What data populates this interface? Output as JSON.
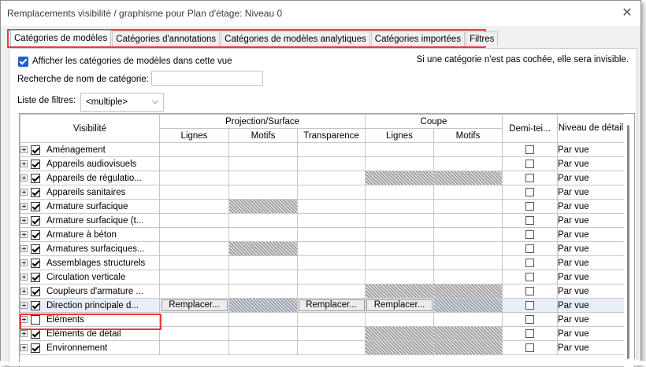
{
  "window": {
    "title": "Remplacements visibilité / graphisme pour Plan d'étage: Niveau 0",
    "close_icon": "close-icon"
  },
  "tabs": [
    {
      "label": "Catégories de modèles",
      "active": true
    },
    {
      "label": "Catégories d'annotations",
      "active": false
    },
    {
      "label": "Catégories de modèles analytiques",
      "active": false
    },
    {
      "label": "Catégories importées",
      "active": false
    },
    {
      "label": "Filtres",
      "active": false
    }
  ],
  "options": {
    "show_label": "Afficher les catégories de modèles dans cette vue",
    "show_checked": true,
    "hint": "Si une catégorie n'est pas cochée, elle sera invisible.",
    "search_label": "Recherche de nom de catégorie:",
    "search_value": "",
    "filter_label": "Liste de filtres:",
    "filter_value": "<multiple>"
  },
  "columns": {
    "visibility": "Visibilité",
    "projection_group": "Projection/Surface",
    "section_group": "Coupe",
    "lines": "Lignes",
    "patterns": "Motifs",
    "transparency": "Transparence",
    "halftone": "Demi-tei...",
    "detail_level": "Niveau de détail"
  },
  "rows": [
    {
      "name": "Aménagement",
      "visible": true,
      "hatch_section": false,
      "hatch_proj_patterns": false,
      "level": "Par vue"
    },
    {
      "name": "Appareils audiovisuels",
      "visible": true,
      "hatch_section": false,
      "hatch_proj_patterns": false,
      "level": "Par vue"
    },
    {
      "name": "Appareils de régulatio...",
      "visible": true,
      "hatch_section": true,
      "hatch_proj_patterns": false,
      "level": "Par vue"
    },
    {
      "name": "Appareils sanitaires",
      "visible": true,
      "hatch_section": false,
      "hatch_proj_patterns": false,
      "level": "Par vue"
    },
    {
      "name": "Armature surfacique",
      "visible": true,
      "hatch_section": false,
      "hatch_proj_patterns": true,
      "level": "Par vue"
    },
    {
      "name": "Armature surfacique (t...",
      "visible": true,
      "hatch_section": false,
      "hatch_proj_patterns": false,
      "level": "Par vue"
    },
    {
      "name": "Armature à béton",
      "visible": true,
      "hatch_section": false,
      "hatch_proj_patterns": false,
      "level": "Par vue"
    },
    {
      "name": "Armatures surfaciques...",
      "visible": true,
      "hatch_section": false,
      "hatch_proj_patterns": true,
      "level": "Par vue"
    },
    {
      "name": "Assemblages structurels",
      "visible": true,
      "hatch_section": false,
      "hatch_proj_patterns": false,
      "level": "Par vue"
    },
    {
      "name": "Circulation verticale",
      "visible": true,
      "hatch_section": false,
      "hatch_proj_patterns": false,
      "level": "Par vue"
    },
    {
      "name": "Coupleurs d'armature ...",
      "visible": true,
      "hatch_section": true,
      "hatch_proj_patterns": false,
      "level": "Par vue"
    },
    {
      "name": "Direction principale d...",
      "visible": true,
      "hatch_section": true,
      "hatch_proj_patterns": false,
      "level": "Par vue",
      "selected": true,
      "replace_label": "Remplacer..."
    },
    {
      "name": "Eléments",
      "visible": false,
      "hatch_section": false,
      "hatch_proj_patterns": false,
      "level": "Par vue"
    },
    {
      "name": "Eléments de détail",
      "visible": true,
      "hatch_section": true,
      "hatch_proj_patterns": false,
      "level": "Par vue"
    },
    {
      "name": "Environnement",
      "visible": true,
      "hatch_section": true,
      "hatch_proj_patterns": false,
      "level": "Par vue"
    }
  ]
}
